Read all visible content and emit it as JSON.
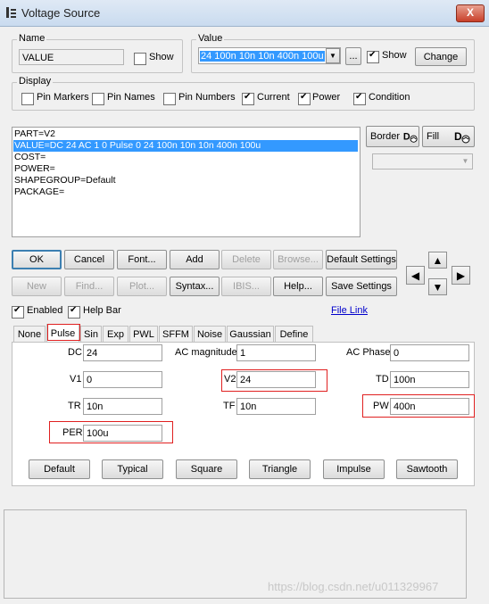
{
  "window": {
    "title": "Voltage Source",
    "close": "X"
  },
  "name_group": {
    "label": "Name",
    "value": "VALUE",
    "show_label": "Show",
    "show_checked": false
  },
  "value_group": {
    "label": "Value",
    "value": "24 100n 10n 10n 400n 100u",
    "browse_label": "...",
    "show_label": "Show",
    "show_checked": true,
    "change_label": "Change"
  },
  "display_group": {
    "label": "Display",
    "items": [
      {
        "label": "Pin Markers",
        "checked": false
      },
      {
        "label": "Pin Names",
        "checked": false
      },
      {
        "label": "Pin Numbers",
        "checked": false
      },
      {
        "label": "Current",
        "checked": true
      },
      {
        "label": "Power",
        "checked": true
      },
      {
        "label": "Condition",
        "checked": true
      }
    ]
  },
  "attributes": [
    "PART=V2",
    "VALUE=DC 24 AC 1 0 Pulse 0 24 100n 10n 10n 400n 100u",
    "COST=",
    "POWER=",
    "SHAPEGROUP=Default",
    "PACKAGE="
  ],
  "selected_attribute": 1,
  "border_label": "Border",
  "fill_label": "Fill",
  "buttons_row1": [
    {
      "label": "OK",
      "enabled": true
    },
    {
      "label": "Cancel",
      "enabled": true
    },
    {
      "label": "Font...",
      "enabled": true
    },
    {
      "label": "Add",
      "enabled": true
    },
    {
      "label": "Delete",
      "enabled": false
    },
    {
      "label": "Browse...",
      "enabled": false
    },
    {
      "label": "Default Settings",
      "enabled": true
    }
  ],
  "buttons_row2": [
    {
      "label": "New",
      "enabled": false
    },
    {
      "label": "Find...",
      "enabled": false
    },
    {
      "label": "Plot...",
      "enabled": false
    },
    {
      "label": "Syntax...",
      "enabled": true
    },
    {
      "label": "IBIS...",
      "enabled": false
    },
    {
      "label": "Help...",
      "enabled": true
    },
    {
      "label": "Save Settings",
      "enabled": true
    }
  ],
  "enabled_label": "Enabled",
  "helpbar_label": "Help Bar",
  "file_link": "File Link",
  "tabs": [
    "None",
    "Pulse",
    "Sin",
    "Exp",
    "PWL",
    "SFFM",
    "Noise",
    "Gaussian",
    "Define"
  ],
  "selected_tab": 1,
  "params": {
    "dc": {
      "label": "DC",
      "value": "24"
    },
    "acm": {
      "label": "AC magnitude",
      "value": "1"
    },
    "acp": {
      "label": "AC Phase",
      "value": "0"
    },
    "v1": {
      "label": "V1",
      "value": "0"
    },
    "v2": {
      "label": "V2",
      "value": "24"
    },
    "td": {
      "label": "TD",
      "value": "100n"
    },
    "tr": {
      "label": "TR",
      "value": "10n"
    },
    "tf": {
      "label": "TF",
      "value": "10n"
    },
    "pw": {
      "label": "PW",
      "value": "400n"
    },
    "per": {
      "label": "PER",
      "value": "100u"
    }
  },
  "preset_buttons": [
    "Default",
    "Typical",
    "Square",
    "Triangle",
    "Impulse",
    "Sawtooth"
  ],
  "watermark": "https://blog.csdn.net/u011329967",
  "colors": {
    "highlight": "#3399ff",
    "annotation_red": "#e02020",
    "link": "#0000cc"
  }
}
